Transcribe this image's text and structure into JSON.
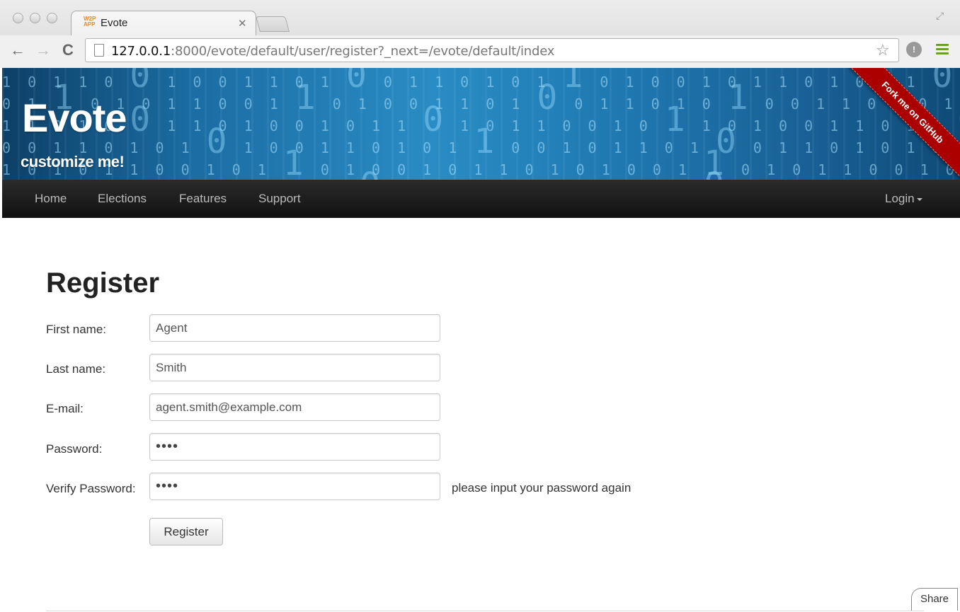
{
  "browser": {
    "tab_title": "Evote",
    "tab_favicon": "W2P APP",
    "url_host": "127.0.0.1",
    "url_rest": ":8000/evote/default/user/register?_next=/evote/default/index",
    "icons": [
      "back-icon",
      "forward-icon",
      "reload-icon",
      "page-icon",
      "star-icon",
      "extension-icon",
      "menu-icon",
      "fullscreen-icon"
    ]
  },
  "banner": {
    "brand": "Evote",
    "tagline": "customize me!",
    "ribbon": "Fork me on GitHub"
  },
  "nav": {
    "items": [
      "Home",
      "Elections",
      "Features",
      "Support"
    ],
    "login": "Login"
  },
  "form": {
    "title": "Register",
    "first_name_label": "First name:",
    "first_name_value": "Agent",
    "last_name_label": "Last name:",
    "last_name_value": "Smith",
    "email_label": "E-mail:",
    "email_value": "agent.smith@example.com",
    "password_label": "Password:",
    "password_value": "••••",
    "verify_label": "Verify Password:",
    "verify_value": "••••",
    "verify_help": "please input your password again",
    "submit_label": "Register"
  },
  "share_label": "Share",
  "colors": {
    "navbar": "#1b1b1b",
    "ribbon": "#aa0000",
    "banner": "#2a8cc4"
  }
}
